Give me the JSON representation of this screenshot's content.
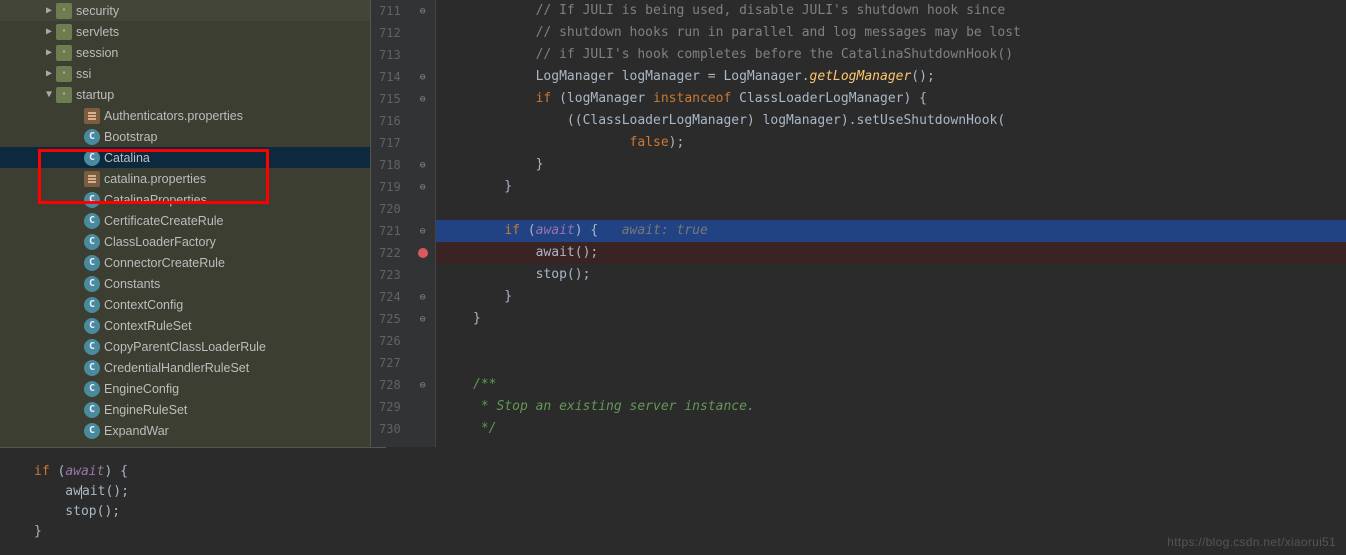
{
  "tree": {
    "items": [
      {
        "level": 3,
        "arrow": "collapsed",
        "icon": "pkg",
        "label": "security"
      },
      {
        "level": 3,
        "arrow": "collapsed",
        "icon": "pkg",
        "label": "servlets"
      },
      {
        "level": 3,
        "arrow": "collapsed",
        "icon": "pkg",
        "label": "session"
      },
      {
        "level": 3,
        "arrow": "collapsed",
        "icon": "pkg",
        "label": "ssi"
      },
      {
        "level": 3,
        "arrow": "expanded",
        "icon": "pkg",
        "label": "startup"
      },
      {
        "level": 5,
        "arrow": "none",
        "icon": "props",
        "label": "Authenticators.properties"
      },
      {
        "level": 5,
        "arrow": "none",
        "icon": "cls",
        "label": "Bootstrap"
      },
      {
        "level": 5,
        "arrow": "none",
        "icon": "cls",
        "label": "Catalina",
        "selected": true
      },
      {
        "level": 5,
        "arrow": "none",
        "icon": "props",
        "label": "catalina.properties"
      },
      {
        "level": 5,
        "arrow": "none",
        "icon": "cls",
        "label": "CatalinaProperties"
      },
      {
        "level": 5,
        "arrow": "none",
        "icon": "cls",
        "label": "CertificateCreateRule"
      },
      {
        "level": 5,
        "arrow": "none",
        "icon": "cls",
        "label": "ClassLoaderFactory"
      },
      {
        "level": 5,
        "arrow": "none",
        "icon": "cls",
        "label": "ConnectorCreateRule"
      },
      {
        "level": 5,
        "arrow": "none",
        "icon": "cls",
        "label": "Constants"
      },
      {
        "level": 5,
        "arrow": "none",
        "icon": "cls",
        "label": "ContextConfig"
      },
      {
        "level": 5,
        "arrow": "none",
        "icon": "cls",
        "label": "ContextRuleSet"
      },
      {
        "level": 5,
        "arrow": "none",
        "icon": "cls",
        "label": "CopyParentClassLoaderRule"
      },
      {
        "level": 5,
        "arrow": "none",
        "icon": "cls",
        "label": "CredentialHandlerRuleSet"
      },
      {
        "level": 5,
        "arrow": "none",
        "icon": "cls",
        "label": "EngineConfig"
      },
      {
        "level": 5,
        "arrow": "none",
        "icon": "cls",
        "label": "EngineRuleSet"
      },
      {
        "level": 5,
        "arrow": "none",
        "icon": "cls",
        "label": "ExpandWar"
      }
    ]
  },
  "editor": {
    "first_line": 711,
    "lines": [
      {
        "n": 711,
        "marker": "fold",
        "html": "            <span class='com'>// If JULI is being used, disable JULI's shutdown hook since</span>"
      },
      {
        "n": 712,
        "marker": "",
        "html": "            <span class='com'>// shutdown hooks run in parallel and log messages may be lost</span>"
      },
      {
        "n": 713,
        "marker": "",
        "html": "            <span class='com'>// if JULI's hook completes before the CatalinaShutdownHook()</span>"
      },
      {
        "n": 714,
        "marker": "fold",
        "html": "            <span class='type'>LogManager logManager = LogManager.</span><span class='call' style='font-style:italic'>getLogManager</span>();"
      },
      {
        "n": 715,
        "marker": "fold",
        "html": "            <span class='kw'>if </span>(logManager <span class='kw'>instanceof</span> ClassLoaderLogManager) {"
      },
      {
        "n": 716,
        "marker": "",
        "html": "                ((ClassLoaderLogManager) logManager).setUseShutdownHook("
      },
      {
        "n": 717,
        "marker": "",
        "html": "                        <span class='kw'>false</span>);"
      },
      {
        "n": 718,
        "marker": "fold",
        "html": "            }"
      },
      {
        "n": 719,
        "marker": "fold",
        "html": "        }"
      },
      {
        "n": 720,
        "marker": "",
        "html": ""
      },
      {
        "n": 721,
        "marker": "fold",
        "hl": true,
        "html": "        <span class='kw'>if </span>(<span class='field'>await</span>) {   <span class='param-hint'>await: true</span>"
      },
      {
        "n": 722,
        "marker": "bp",
        "bpline": true,
        "html": "            await();"
      },
      {
        "n": 723,
        "marker": "",
        "html": "            stop();"
      },
      {
        "n": 724,
        "marker": "fold",
        "html": "        }"
      },
      {
        "n": 725,
        "marker": "fold",
        "html": "    }"
      },
      {
        "n": 726,
        "marker": "",
        "html": ""
      },
      {
        "n": 727,
        "marker": "",
        "html": ""
      },
      {
        "n": 728,
        "marker": "fold",
        "html": "    <span class='com-doc'>/**</span>"
      },
      {
        "n": 729,
        "marker": "",
        "html": "<span class='com-doc'>     * Stop an existing server instance.</span>"
      },
      {
        "n": 730,
        "marker": "",
        "html": "<span class='com-doc'>     */</span>"
      }
    ]
  },
  "bottom_panel": {
    "lines": [
      {
        "html": "<span class='kw'>if </span>(<span class='field'>await</span>) {"
      },
      {
        "html": "    aw<span class='cursor'></span>ait();"
      },
      {
        "html": "    stop();"
      },
      {
        "html": "}"
      }
    ]
  },
  "watermark": "https://blog.csdn.net/xiaorui51"
}
